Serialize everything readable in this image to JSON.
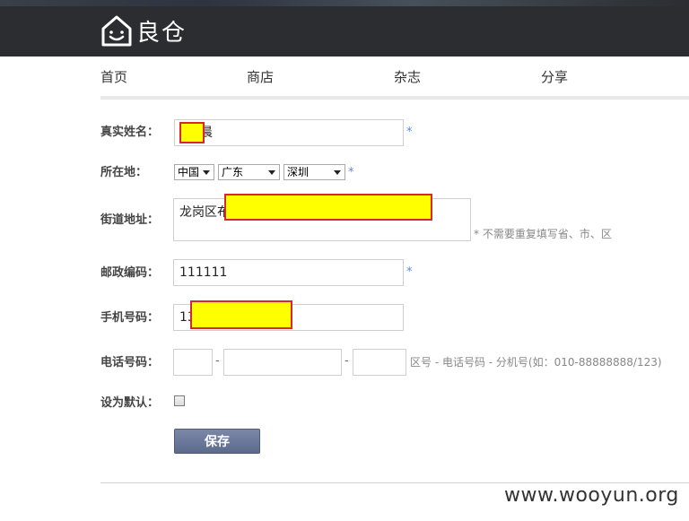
{
  "header": {
    "logo_text": "良仓"
  },
  "nav": {
    "items": [
      "首页",
      "商店",
      "杂志",
      "分享"
    ]
  },
  "form": {
    "real_name": {
      "label": "真实姓名：",
      "value_suffix": "晨",
      "required": "*"
    },
    "location": {
      "label": "所在地：",
      "country": "中国",
      "province": "广东",
      "city": "深圳",
      "required": "*"
    },
    "street": {
      "label": "街道地址：",
      "value_prefix": "龙岗区布",
      "hint": "* 不需要重复填写省、市、区"
    },
    "postal": {
      "label": "邮政编码：",
      "value": "111111",
      "required": "*"
    },
    "mobile": {
      "label": "手机号码：",
      "value_prefix": "13"
    },
    "phone": {
      "label": "电话号码：",
      "sep": "-",
      "hint": "区号 - 电话号码 - 分机号(如：010-88888888/123)"
    },
    "default": {
      "label": "设为默认："
    },
    "save_label": "保存"
  },
  "watermark": "www.wooyun.org",
  "colors": {
    "header_bg": "#2b2d31",
    "redaction_fill": "#ffff00",
    "redaction_border": "#d62a2a",
    "required": "#5a8bd6",
    "save_button": "#6a7799"
  }
}
